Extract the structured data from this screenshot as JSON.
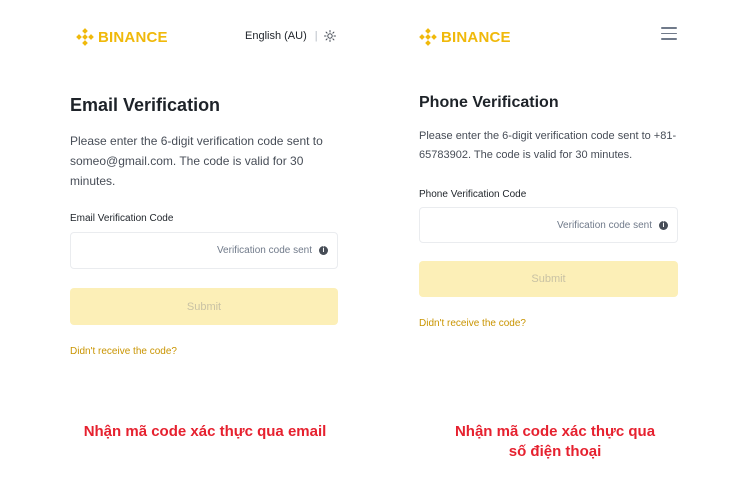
{
  "left_panel": {
    "logo_text": "BINANCE",
    "language": "English (AU)",
    "title": "Email Verification",
    "description": "Please enter the 6-digit verification code sent to someo@gmail.com. The code is valid for 30 minutes.",
    "field_label": "Email Verification Code",
    "input_status": "Verification code sent",
    "submit_label": "Submit",
    "resend_link": "Didn't receive the code?"
  },
  "right_panel": {
    "logo_text": "BINANCE",
    "title": "Phone Verification",
    "description": "Please enter the 6-digit verification code sent to +81-65783902. The code is valid for 30 minutes.",
    "field_label": "Phone Verification Code",
    "input_status": "Verification code sent",
    "submit_label": "Submit",
    "resend_link": "Didn't receive the code?"
  },
  "captions": {
    "left": "Nhận mã code xác thực qua email",
    "right_line1": "Nhận mã code xác thực qua",
    "right_line2": "số điện thoại"
  },
  "colors": {
    "brand": "#f0b90b",
    "link": "#c99400",
    "submit_disabled_bg": "#fcefb7",
    "caption": "#e6212f"
  },
  "icons": [
    "binance-logo-icon",
    "theme-sun-icon",
    "hamburger-menu-icon",
    "info-icon"
  ]
}
